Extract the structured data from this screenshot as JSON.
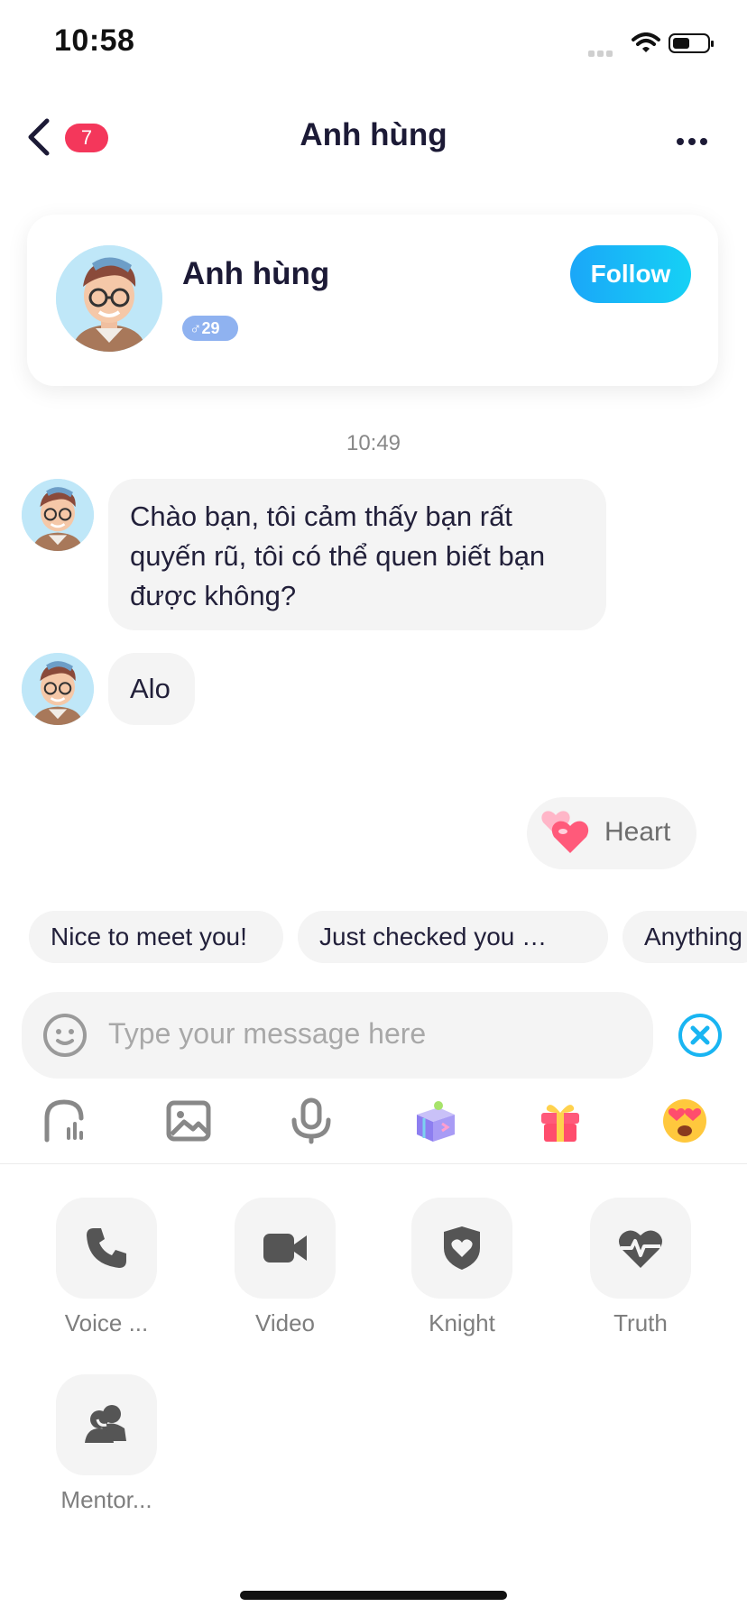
{
  "status_bar": {
    "time": "10:58"
  },
  "header": {
    "title": "Anh hùng",
    "unread_count": "7"
  },
  "profile": {
    "name": "Anh hùng",
    "gender_symbol": "♂",
    "age": "29",
    "follow_label": "Follow"
  },
  "chat": {
    "timestamp": "10:49",
    "messages": [
      {
        "text": "Chào bạn, tôi cảm thấy bạn rất quyến rũ, tôi có thể quen biết bạn được không?"
      },
      {
        "text": "Alo"
      }
    ],
    "sent_sticker": {
      "label": "Heart"
    }
  },
  "quick_replies": [
    "Nice to meet you!",
    "Just checked you …",
    "Anything"
  ],
  "composer": {
    "placeholder": "Type your message here"
  },
  "toolbar": {
    "icons": [
      "voice-room-icon",
      "image-icon",
      "microphone-icon",
      "gift-box-icon",
      "present-icon",
      "heart-eyes-emoji-icon"
    ]
  },
  "actions": [
    {
      "label": "Voice ...",
      "icon": "phone-icon"
    },
    {
      "label": "Video",
      "icon": "video-camera-icon"
    },
    {
      "label": "Knight",
      "icon": "shield-heart-icon"
    },
    {
      "label": "Truth",
      "icon": "heartbeat-icon"
    },
    {
      "label": "Mentor...",
      "icon": "people-icon"
    }
  ]
}
